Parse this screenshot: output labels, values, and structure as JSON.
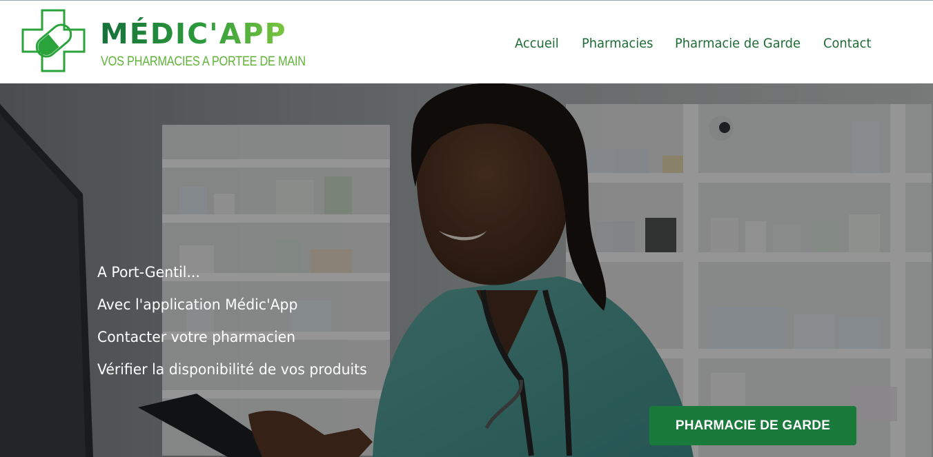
{
  "brand": {
    "name": "MÉDIC'APP",
    "tagline": "VOS PHARMACIES A PORTEE DE MAIN",
    "logo_icon": "cross-pill-icon",
    "colors": {
      "dark_green": "#15713a",
      "green": "#2d9b3c",
      "light_green": "#7cc63f"
    }
  },
  "nav": {
    "items": [
      {
        "label": "Accueil"
      },
      {
        "label": "Pharmacies"
      },
      {
        "label": "Pharmacie de Garde"
      },
      {
        "label": "Contact"
      }
    ],
    "color": "#1e6b35"
  },
  "hero": {
    "lines": [
      "A Port-Gentil...",
      "Avec l'application Médic'App",
      "Contacter votre pharmacien",
      "Vérifier la disponibilité de vos produits"
    ],
    "background_image": "pharmacist-with-tablet-photo"
  },
  "cta": {
    "label": "PHARMACIE DE GARDE",
    "color": "#1a7a3c"
  }
}
